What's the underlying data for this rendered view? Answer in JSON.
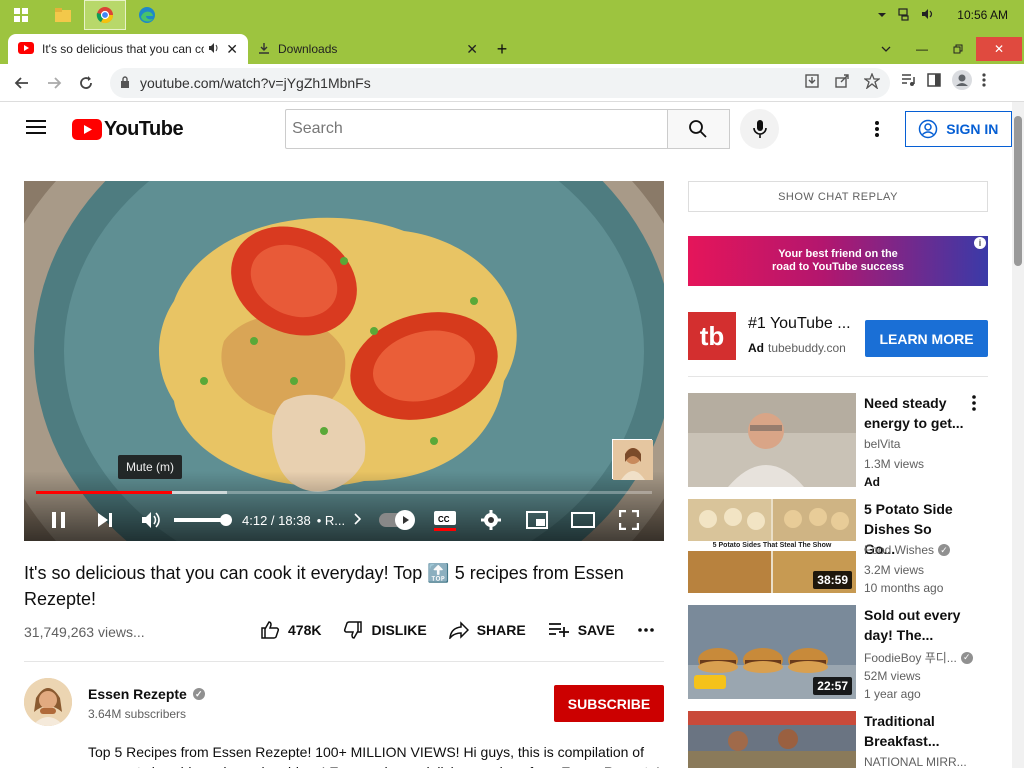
{
  "taskbar": {
    "time": "10:56 AM"
  },
  "browser": {
    "tabs": [
      {
        "title": "It's so delicious that you can cook it everyday",
        "active": true
      },
      {
        "title": "Downloads",
        "active": false
      }
    ],
    "url": "youtube.com/watch?v=jYgZh1MbnFs"
  },
  "header": {
    "logo_text": "YouTube",
    "search_placeholder": "Search",
    "signin_label": "SIGN IN"
  },
  "player": {
    "tooltip": "Mute (m)",
    "current_time": "4:12",
    "duration": "18:38",
    "time_separator": " / ",
    "chapter_text": "• R...",
    "progress_played": 0.22,
    "progress_buffered": 0.31,
    "volume": 0.9
  },
  "video": {
    "title": "It's so delicious that you can cook it everyday! Top 🔝 5 recipes from Essen Rezepte!",
    "views": "31,749,263 views...",
    "likes": "478K",
    "dislike_label": "DISLIKE",
    "share_label": "SHARE",
    "save_label": "SAVE"
  },
  "channel": {
    "name": "Essen Rezepte",
    "subscribers": "3.64M subscribers",
    "subscribe_label": "SUBSCRIBE",
    "description": "Top 5 Recipes from Essen Rezepte! 100+ MILLION VIEWS! Hi guys, this is compilation of my most viewable and popular videos! Easy and very delicious recipes from Essen Rezepte! Try"
  },
  "sidebar": {
    "chat_replay_label": "SHOW CHAT REPLAY",
    "banner_text_line1": "Your best friend on the",
    "banner_text_line2": "road to YouTube success",
    "ad": {
      "logo_text": "tb",
      "title": "#1 YouTube ...",
      "ad_label": "Ad",
      "domain": "tubebuddy.con",
      "cta": "LEARN MORE"
    },
    "recommendations": [
      {
        "title": "Need steady energy to get...",
        "channel": "belVita",
        "meta1": "1.3M views",
        "meta2": "Ad",
        "duration": "",
        "verified": false
      },
      {
        "title": "5 Potato Side Dishes So Go...",
        "channel": "Food Wishes",
        "meta1": "3.2M views",
        "meta2": "10 months ago",
        "duration": "38:59",
        "verified": true,
        "thumb_caption": "5 Potato Sides That Steal The Show"
      },
      {
        "title": "Sold out every day! The...",
        "channel": "FoodieBoy 푸디...",
        "meta1": "52M views",
        "meta2": "1 year ago",
        "duration": "22:57",
        "verified": true
      },
      {
        "title": "Traditional Breakfast...",
        "channel": "NATIONAL MIRR...",
        "meta1": "",
        "meta2": "",
        "duration": "",
        "verified": false
      }
    ]
  },
  "colors": {
    "taskbar": "#9dc43f",
    "yt_red": "#ff0000",
    "subscribe_red": "#cc0000",
    "link_blue": "#065fd4",
    "learn_more_blue": "#1a6fd6"
  }
}
